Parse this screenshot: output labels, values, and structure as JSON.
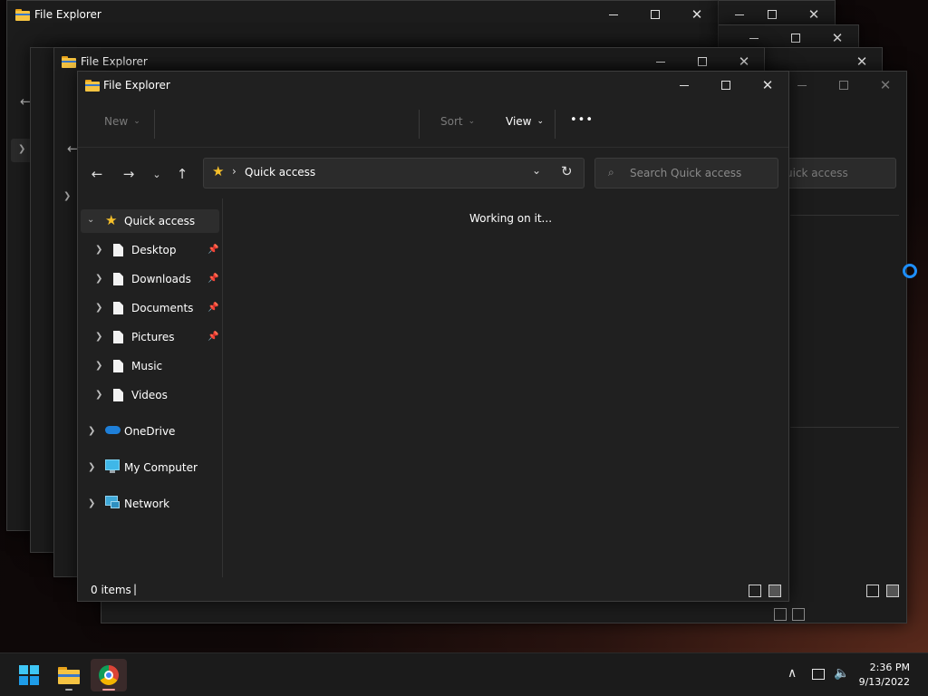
{
  "window": {
    "title": "File Explorer",
    "toolbar": {
      "new": "New",
      "sort": "Sort",
      "view": "View",
      "more": "•••"
    },
    "address": {
      "location": "Quick access",
      "separator": "›"
    },
    "search": {
      "placeholder": "Search Quick access"
    },
    "content_message": "Working on it...",
    "status": {
      "items_count": "0 items",
      "cursor": "|"
    }
  },
  "back_windows": {
    "title_1": "File Explorer",
    "title_2": "File Explorer",
    "search_fragment": "uick access"
  },
  "sidebar": {
    "quick_access": "Quick access",
    "items": [
      {
        "label": "Desktop",
        "pinned": true
      },
      {
        "label": "Downloads",
        "pinned": true
      },
      {
        "label": "Documents",
        "pinned": true
      },
      {
        "label": "Pictures",
        "pinned": true
      },
      {
        "label": "Music",
        "pinned": false
      },
      {
        "label": "Videos",
        "pinned": false
      }
    ],
    "onedrive": "OneDrive",
    "my_computer": "My Computer",
    "network": "Network"
  },
  "taskbar": {
    "time": "2:36 PM",
    "date": "9/13/2022",
    "icons": [
      "windows-start-icon",
      "file-explorer-icon",
      "chrome-icon"
    ]
  },
  "colors": {
    "window_bg": "#202020",
    "accent_blue": "#1e8fff",
    "folder_yellow": "#f5c342",
    "star_yellow": "#f6c02a"
  }
}
